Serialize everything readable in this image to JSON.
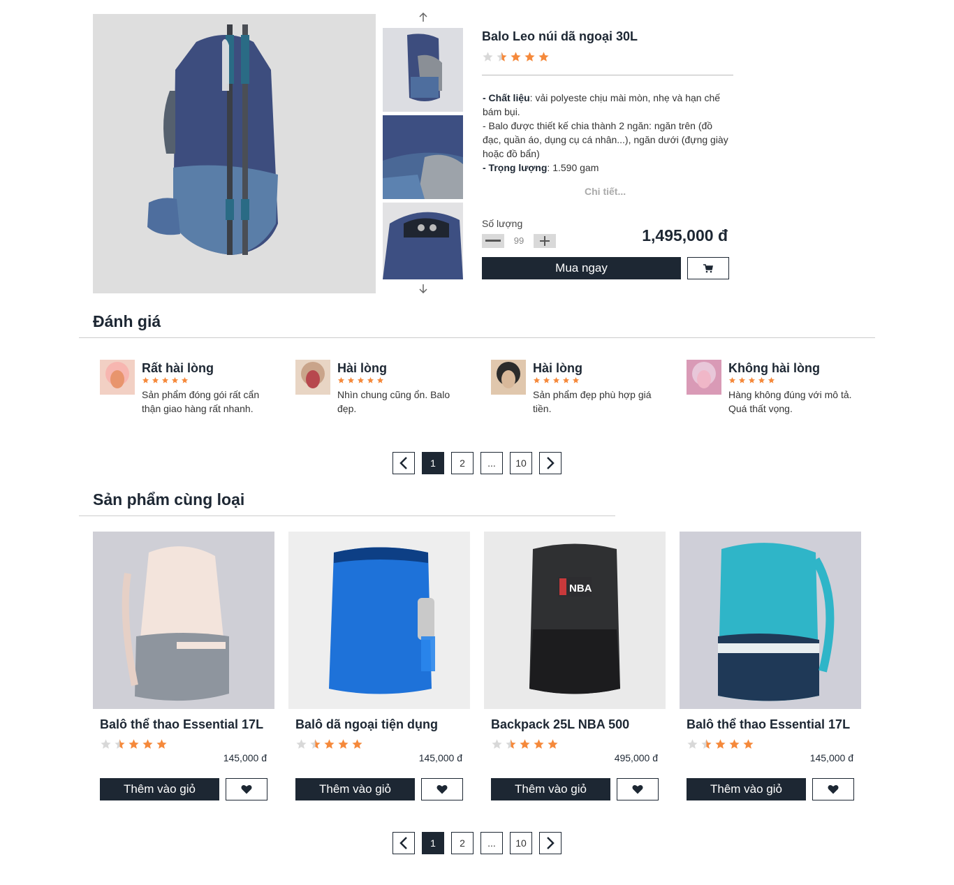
{
  "product": {
    "title": "Balo Leo núi dã ngoại 30L",
    "rating": 3.5,
    "desc": {
      "material_label": "- Chất liệu",
      "material_text": ": vải polyeste chịu mài mòn, nhẹ và hạn chế bám bụi.",
      "design_text": "- Balo được thiết kế chia thành 2 ngăn: ngăn trên (đồ đạc, quần áo, dụng cụ cá nhân...), ngăn dưới (đựng giày hoặc đồ bẩn)",
      "weight_label": "- Trọng lượng",
      "weight_text": ": 1.590 gam"
    },
    "more_link": "Chi tiết...",
    "qty_label": "Số lượng",
    "qty_value": "99",
    "price": "1,495,000 đ",
    "buy_label": "Mua ngay"
  },
  "reviews_section": {
    "title": "Đánh giá",
    "reviews": [
      {
        "title": "Rất hài lòng",
        "text": "Sản phẩm đóng gói rất cẩn thận giao hàng rất nhanh.",
        "rating": 5
      },
      {
        "title": "Hài lòng",
        "text": "Nhìn chung cũng ổn. Balo đẹp.",
        "rating": 5
      },
      {
        "title": "Hài lòng",
        "text": "Sản phẩm đẹp phù hợp giá tiền.",
        "rating": 5
      },
      {
        "title": "Không hài lòng",
        "text": "Hàng không đúng với mô tả. Quá thất vọng.",
        "rating": 5
      }
    ]
  },
  "pagination": {
    "pages": [
      "1",
      "2",
      "...",
      "10"
    ],
    "active": "1"
  },
  "related_section": {
    "title": "Sản phẩm cùng loại",
    "add_label": "Thêm vào giỏ",
    "items": [
      {
        "name": "Balô thể thao Essential 17L",
        "price": "145,000 đ",
        "rating": 3.5
      },
      {
        "name": "Balô dã ngoại tiện dụng",
        "price": "145,000 đ",
        "rating": 3.5
      },
      {
        "name": "Backpack 25L NBA 500",
        "price": "495,000 đ",
        "rating": 3.5
      },
      {
        "name": "Balô thể thao Essential 17L",
        "price": "145,000 đ",
        "rating": 3.5
      }
    ]
  },
  "colors": {
    "primary": "#1d2733",
    "star_on": "#f5893b",
    "star_off": "#d8d8d8"
  }
}
